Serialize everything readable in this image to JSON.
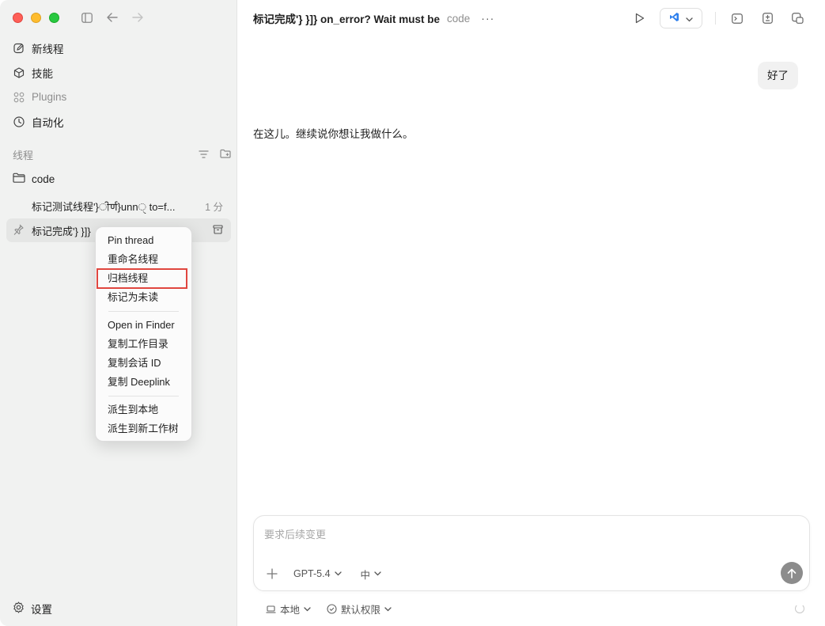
{
  "sidebar": {
    "nav": [
      {
        "label": "新线程",
        "icon": "edit-icon"
      },
      {
        "label": "技能",
        "icon": "cube-icon"
      },
      {
        "label": "Plugins",
        "icon": "grid-icon"
      },
      {
        "label": "自动化",
        "icon": "clock-icon"
      }
    ],
    "section_label": "线程",
    "folder": "code",
    "threads": [
      {
        "title": "标记测试线程'}ੀर्ण}unnੑ to=f...",
        "time": "1 分"
      },
      {
        "title": "标记完成'} }]}"
      }
    ],
    "settings_label": "设置"
  },
  "context_menu": {
    "group1": [
      "Pin thread",
      "重命名线程",
      "归档线程",
      "标记为未读"
    ],
    "group2": [
      "Open in Finder",
      "复制工作目录",
      "复制会话 ID",
      "复制 Deeplink"
    ],
    "group3": [
      "派生到本地",
      "派生到新工作树"
    ],
    "highlighted": "归档线程"
  },
  "main": {
    "title": "标记完成'} }]} on_error? Wait must be",
    "project": "code",
    "more": "···",
    "user_message": "好了",
    "assistant_message": "在这儿。继续说你想让我做什么。",
    "composer": {
      "placeholder": "要求后续变更",
      "model": "GPT-5.4",
      "effort": "中"
    },
    "footer": {
      "location": "本地",
      "permission": "默认权限"
    }
  },
  "colors": {
    "highlight": "#e0463f",
    "vscode": "#2f80ed"
  }
}
